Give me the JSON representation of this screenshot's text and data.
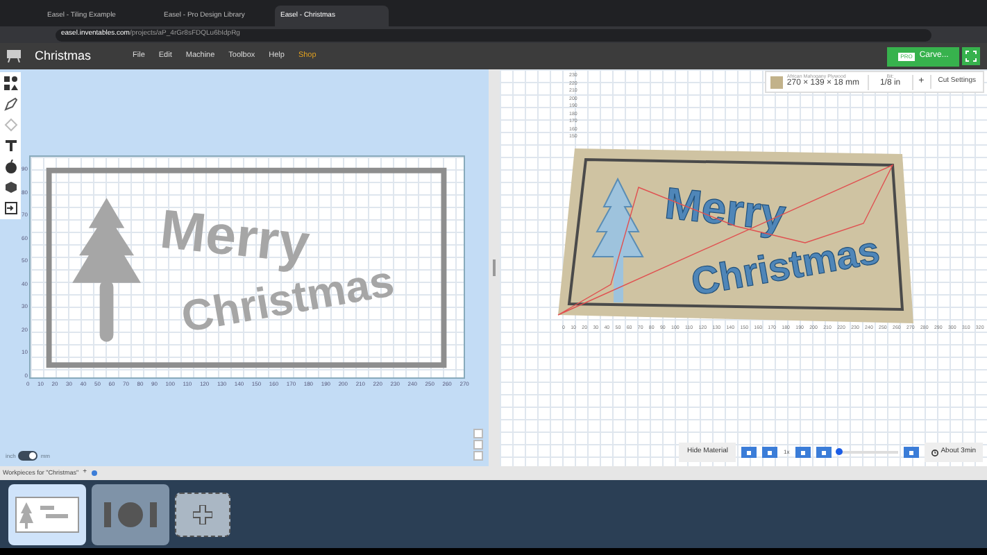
{
  "browser": {
    "tabs": [
      {
        "title": "Easel - Tiling Example",
        "selected": false
      },
      {
        "title": "Easel - Pro Design Library",
        "selected": false
      },
      {
        "title": "Easel - Christmas",
        "selected": true
      }
    ],
    "url_host": "easel.inventables.com",
    "url_path": "/projects/aP_4rGr8sFDQLu6bIdpRg"
  },
  "app": {
    "title": "Christmas",
    "menu": [
      "File",
      "Edit",
      "Machine",
      "Toolbox",
      "Help",
      "Shop"
    ],
    "carve_badge": "PRO",
    "carve_label": "Carve..."
  },
  "tools": [
    {
      "kind": "shapes"
    },
    {
      "kind": "pen"
    },
    {
      "kind": "node"
    },
    {
      "kind": "text"
    },
    {
      "kind": "apps"
    },
    {
      "kind": "import3d"
    },
    {
      "kind": "import"
    }
  ],
  "canvas": {
    "design_lines": [
      "Merry",
      "Christmas"
    ],
    "x_ticks": [
      "0",
      "10",
      "20",
      "30",
      "40",
      "50",
      "60",
      "70",
      "80",
      "90",
      "100",
      "110",
      "120",
      "130",
      "140",
      "150",
      "160",
      "170",
      "180",
      "190",
      "200",
      "210",
      "220",
      "230",
      "240",
      "250",
      "260",
      "270"
    ],
    "y_ticks": [
      "90",
      "80",
      "70",
      "60",
      "50",
      "40",
      "30",
      "20",
      "10",
      "0"
    ],
    "units": {
      "left": "inch",
      "right": "mm",
      "on": true
    }
  },
  "material": {
    "name": "African Mahogany Plywood",
    "size": "270 × 139 × 18 mm",
    "bit_label": "Bit:",
    "bit": "1/8 in",
    "add": "+",
    "cut_settings": "Cut Settings"
  },
  "preview": {
    "design_lines": [
      "Merry",
      "Christmas"
    ],
    "y_ticks": [
      "230",
      "220",
      "210",
      "200",
      "190",
      "180",
      "170",
      "160",
      "150"
    ],
    "x_ticks": [
      "0",
      "10",
      "20",
      "30",
      "40",
      "50",
      "60",
      "70",
      "80",
      "90",
      "100",
      "110",
      "120",
      "130",
      "140",
      "150",
      "160",
      "170",
      "180",
      "190",
      "200",
      "210",
      "220",
      "230",
      "240",
      "250",
      "260",
      "270",
      "280",
      "290",
      "300",
      "310",
      "320"
    ],
    "hide_material": "Hide Material",
    "speed": "1x",
    "level": 0.02,
    "estimate": "About 3min"
  },
  "workpieces": {
    "label": "Workpieces for \"Christmas\"",
    "add": "+",
    "items": [
      {
        "kind": "design",
        "selected": true
      },
      {
        "kind": "shapes",
        "selected": false
      },
      {
        "kind": "add",
        "selected": false
      }
    ]
  }
}
